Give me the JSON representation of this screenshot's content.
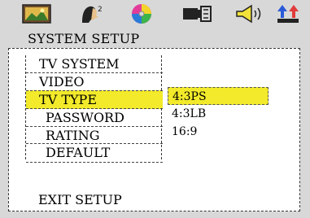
{
  "toolbar": {
    "icons": [
      "landscape-picture-icon",
      "person-profile-icon",
      "color-disc-icon",
      "speaker-settings-icon",
      "audio-speaker-icon",
      "exchange-arrows-icon"
    ]
  },
  "title": "SYSTEM SETUP",
  "menu": {
    "items": [
      {
        "label": "TV SYSTEM"
      },
      {
        "label": "VIDEO"
      },
      {
        "label": "TV TYPE",
        "selected": true
      },
      {
        "label": "PASSWORD"
      },
      {
        "label": "RATING"
      },
      {
        "label": "DEFAULT"
      }
    ]
  },
  "options": {
    "items": [
      {
        "label": "4:3PS",
        "selected": true
      },
      {
        "label": "4:3LB"
      },
      {
        "label": "16:9"
      }
    ]
  },
  "exit_label": "EXIT SETUP",
  "colors": {
    "highlight": "#f2ea2a",
    "background": "#d8d8d8"
  }
}
